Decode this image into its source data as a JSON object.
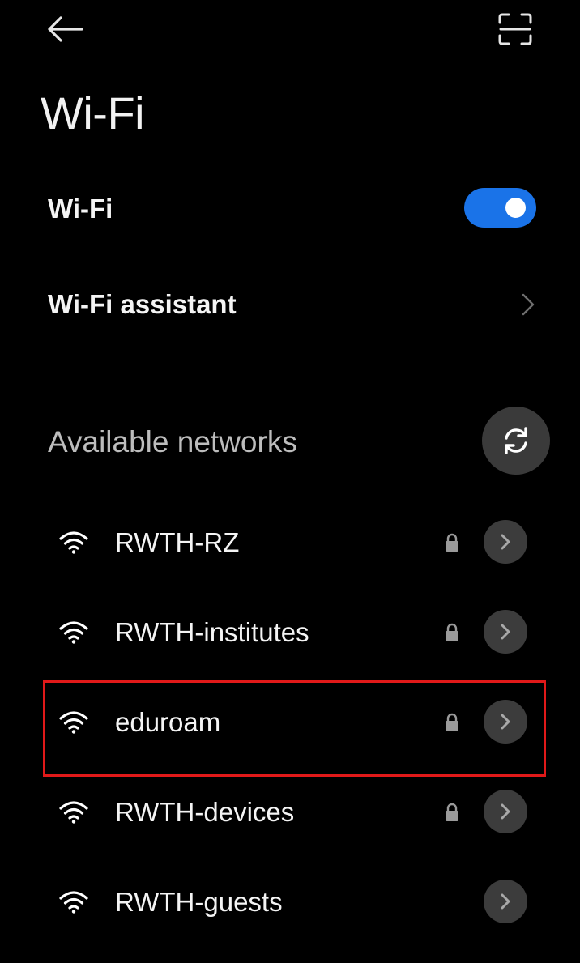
{
  "header": {
    "back_icon": "arrow-left-icon",
    "scan_icon": "scan-frame-icon"
  },
  "page": {
    "title": "Wi-Fi"
  },
  "wifi_toggle": {
    "label": "Wi-Fi",
    "enabled": true,
    "accent_color": "#1a73e8"
  },
  "assistant": {
    "label": "Wi-Fi assistant",
    "chevron_icon": "chevron-right-icon"
  },
  "available": {
    "title": "Available networks",
    "refresh_icon": "refresh-icon"
  },
  "networks": [
    {
      "name": "RWTH-RZ",
      "secured": true
    },
    {
      "name": "RWTH-institutes",
      "secured": true
    },
    {
      "name": "eduroam",
      "secured": true,
      "highlighted": true
    },
    {
      "name": "RWTH-devices",
      "secured": true
    },
    {
      "name": "RWTH-guests",
      "secured": false
    }
  ],
  "highlight_color": "#e01919"
}
